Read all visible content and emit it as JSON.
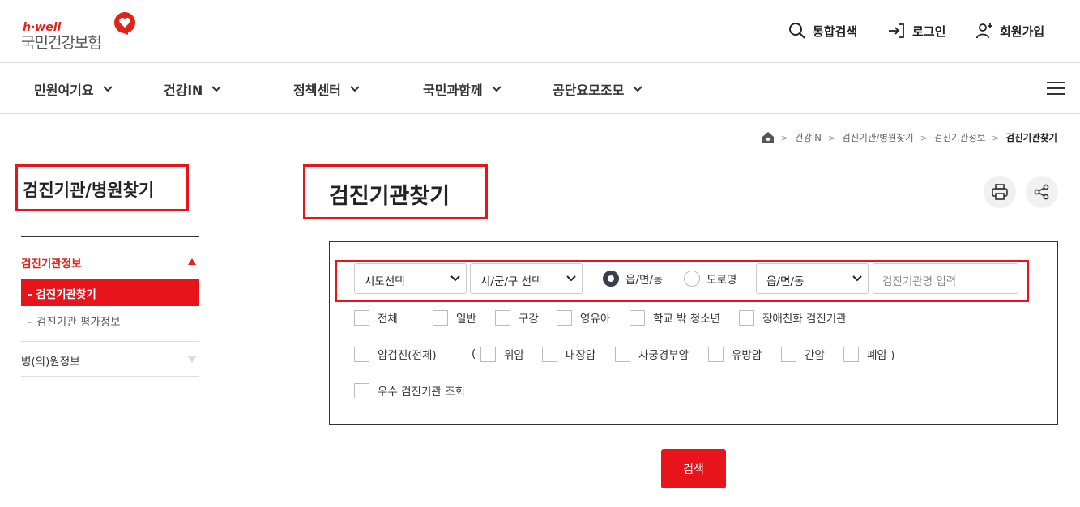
{
  "logo": {
    "sub": "h·well",
    "main": "국민건강보험"
  },
  "header": {
    "utility": [
      {
        "label": "통합검색",
        "icon": "search-icon"
      },
      {
        "label": "로그인",
        "icon": "login-icon"
      },
      {
        "label": "회원가입",
        "icon": "user-add-icon"
      }
    ]
  },
  "gnb": {
    "items": [
      {
        "label": "민원여기요"
      },
      {
        "label": "건강iN"
      },
      {
        "label": "정책센터"
      },
      {
        "label": "국민과함께"
      },
      {
        "label": "공단요모조모"
      }
    ]
  },
  "breadcrumb": {
    "items": [
      "건강iN",
      "검진기관/병원찾기",
      "검진기관정보"
    ],
    "current": "검진기관찾기"
  },
  "sidebar": {
    "title": "검진기관/병원찾기",
    "menu1": "검진기관정보",
    "sub_active": "- 검진기관찾기",
    "sub_dash": "-",
    "sub_item": "검진기관 평가정보",
    "menu2": "병(의)원정보"
  },
  "main": {
    "title": "검진기관찾기"
  },
  "search": {
    "sido": "시도선택",
    "sigungu": "시/군/구 선택",
    "radio_1": "읍/면/동",
    "radio_2": "도로명",
    "eupmyeondong": "읍/면/동",
    "name_placeholder": "검진기관명 입력",
    "checks_row1": [
      "전체",
      "일반",
      "구강",
      "영유아",
      "학교 밖 청소년",
      "장애친화 검진기관"
    ],
    "cancer_all": "암검진(전체)",
    "paren_open": "(",
    "checks_row2": [
      "위암",
      "대장암",
      "자궁경부암",
      "유방암",
      "간암",
      "폐암 )"
    ],
    "excellent": "우수 검진기관 조회",
    "button": "검색"
  },
  "colors": {
    "accent": "#e8141b",
    "brand_red": "#e2231a"
  }
}
